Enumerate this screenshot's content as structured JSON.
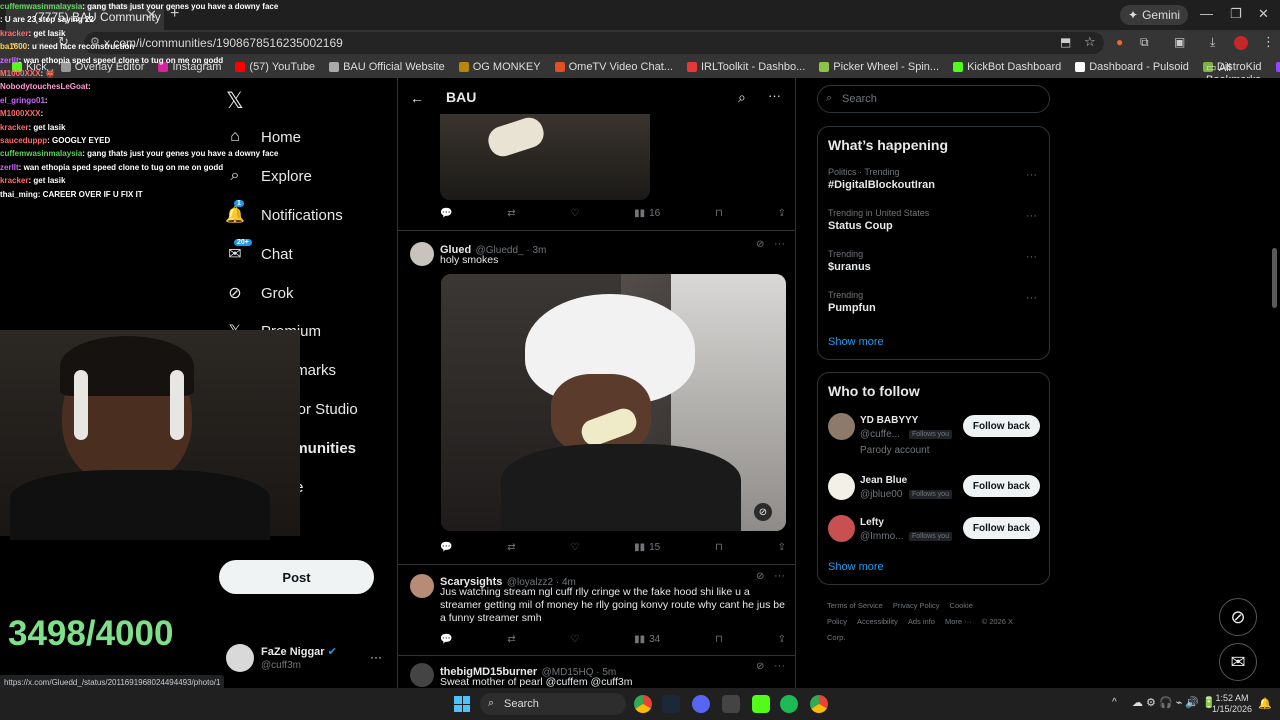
{
  "browser": {
    "tab_title": "(7775) BAU Community / X",
    "tab_close": "✕",
    "new_tab": "+",
    "gemini_label": "Gemini",
    "url": "x.com/i/communities/1908678516235002169",
    "bookmarks": [
      {
        "label": "Kick",
        "color": "#53fc18"
      },
      {
        "label": "Overlay Editor",
        "color": "#999999"
      },
      {
        "label": "Instagram",
        "color": "#d6249f"
      },
      {
        "label": "(57) YouTube",
        "color": "#ff0000"
      },
      {
        "label": "BAU Official Website",
        "color": "#aaaaaa"
      },
      {
        "label": "OG MONKEY",
        "color": "#b8860b"
      },
      {
        "label": "OmeTV Video Chat...",
        "color": "#e44d26"
      },
      {
        "label": "IRLToolkit - Dashbo...",
        "color": "#e53935"
      },
      {
        "label": "Picker Wheel - Spin...",
        "color": "#8bc34a"
      },
      {
        "label": "KickBot Dashboard",
        "color": "#53fc18"
      },
      {
        "label": "Dashboard - Pulsoid",
        "color": "#ffffff"
      },
      {
        "label": "DistroKid",
        "color": "#7cb342"
      },
      {
        "label": "Twitch",
        "color": "#9146ff"
      }
    ],
    "all_bookmarks": "All Bookmarks",
    "status_url": "https://x.com/Gluedd_/status/2011691968024494493/photo/1"
  },
  "nav": {
    "items": [
      {
        "label": "Home",
        "icon": "home-icon",
        "glyph": "⌂"
      },
      {
        "label": "Explore",
        "icon": "search-icon",
        "glyph": "⌕"
      },
      {
        "label": "Notifications",
        "icon": "bell-icon",
        "glyph": "🔔",
        "badge": "1"
      },
      {
        "label": "Chat",
        "icon": "chat-icon",
        "glyph": "✉",
        "badge": "20+"
      },
      {
        "label": "Grok",
        "icon": "grok-icon",
        "glyph": "⊘"
      },
      {
        "label": "Premium",
        "icon": "x-logo-icon",
        "glyph": "𝕏"
      },
      {
        "label": "Bookmarks",
        "icon": "bookmark-icon",
        "glyph": "🔖"
      },
      {
        "label": "Creator Studio",
        "icon": "creator-studio-icon",
        "glyph": "♙"
      },
      {
        "label": "Communities",
        "icon": "communities-icon",
        "glyph": "👥"
      },
      {
        "label": "Profile",
        "icon": "profile-icon",
        "glyph": "👤"
      }
    ],
    "post_label": "Post",
    "account_name": "FaZe Niggar",
    "account_handle": "@cuff3m"
  },
  "header": {
    "title": "BAU"
  },
  "tweets": [
    {
      "views": "16"
    },
    {
      "name": "Glued",
      "handle": "@Gluedd_ · 3m",
      "text": "holy smokes",
      "views": "15"
    },
    {
      "name": "Scarysights",
      "handle": "@loyalzz2 · 4m",
      "text": "Jus watching stream ngl cuff rlly cringe w the fake hood shi like u a streamer getting mil of money he rlly going konvy route why cant he jus be a funny streamer smh",
      "views": "34"
    },
    {
      "name": "thebigMD15burner",
      "handle": "@MD15HQ · 5m",
      "text": "Sweat mother of pearl @cuffem @cuff3m"
    }
  ],
  "search": {
    "placeholder": "Search"
  },
  "trends": {
    "title": "What’s happening",
    "items": [
      {
        "category": "Politics · Trending",
        "name": "#DigitalBlockoutIran"
      },
      {
        "category": "Trending in United States",
        "name": "Status Coup"
      },
      {
        "category": "Trending",
        "name": "$uranus"
      },
      {
        "category": "Trending",
        "name": "Pumpfun"
      }
    ],
    "show_more": "Show more"
  },
  "who_to_follow": {
    "title": "Who to follow",
    "items": [
      {
        "name": "YD BABYYY",
        "handle": "@cuffe...",
        "badge": "Follows you",
        "note": "Parody account",
        "button": "Follow back"
      },
      {
        "name": "Jean Blue",
        "handle": "@jblue00",
        "badge": "Follows you",
        "button": "Follow back"
      },
      {
        "name": "Lefty",
        "handle": "@Immo...",
        "badge": "Follows you",
        "button": "Follow back"
      }
    ],
    "show_more": "Show more"
  },
  "footer": {
    "links": [
      "Terms of Service",
      "Privacy Policy",
      "Cookie Policy",
      "Accessibility",
      "Ads info",
      "More ···",
      "© 2026 X Corp."
    ]
  },
  "stream_overlay": {
    "chat": [
      {
        "user": "cuffemwasinmalaysia",
        "color": "#5bd45b",
        "msg": "gang thats just your genes you have a downy face"
      },
      {
        "user": "",
        "color": "#ffffff",
        "msg": "U are 23 stop saying 22"
      },
      {
        "user": "kracker",
        "color": "#ff6b6b",
        "msg": "get lasik"
      },
      {
        "user": "ba1600",
        "color": "#ffd24d",
        "msg": "u need face reconstruction"
      },
      {
        "user": "zerllt",
        "color": "#cc66ff",
        "msg": "wan ethopia sped speed clone to tug on me on godd"
      },
      {
        "user": "M1000XXX",
        "color": "#ff6b6b",
        "msg": "👹"
      },
      {
        "user": "NobodytouchesLeGoat",
        "color": "#ff9ad5",
        "msg": ""
      },
      {
        "user": "el_gringo01",
        "color": "#cc66ff",
        "msg": ""
      },
      {
        "user": "M1000XXX",
        "color": "#ff6b6b",
        "msg": ""
      },
      {
        "user": "kracker",
        "color": "#ff6b6b",
        "msg": "get lasik"
      },
      {
        "user": "sauceduppp",
        "color": "#ff6b6b",
        "msg": "GOOGLY EYED"
      },
      {
        "user": "cuffemwasinmalaysia",
        "color": "#5bd45b",
        "msg": "gang thats just your genes you have a downy face"
      },
      {
        "user": "zerllt",
        "color": "#cc66ff",
        "msg": "wan ethopia sped speed clone to tug on me on godd"
      },
      {
        "user": "kracker",
        "color": "#ff6b6b",
        "msg": "get lasik"
      },
      {
        "user": "thai_ming",
        "color": "#ffffff",
        "msg": "CAREER OVER IF U FIX IT"
      }
    ],
    "counter": "3498/4000"
  },
  "taskbar": {
    "search_label": "Search",
    "time": "1:52 AM",
    "date": "1/15/2026"
  }
}
